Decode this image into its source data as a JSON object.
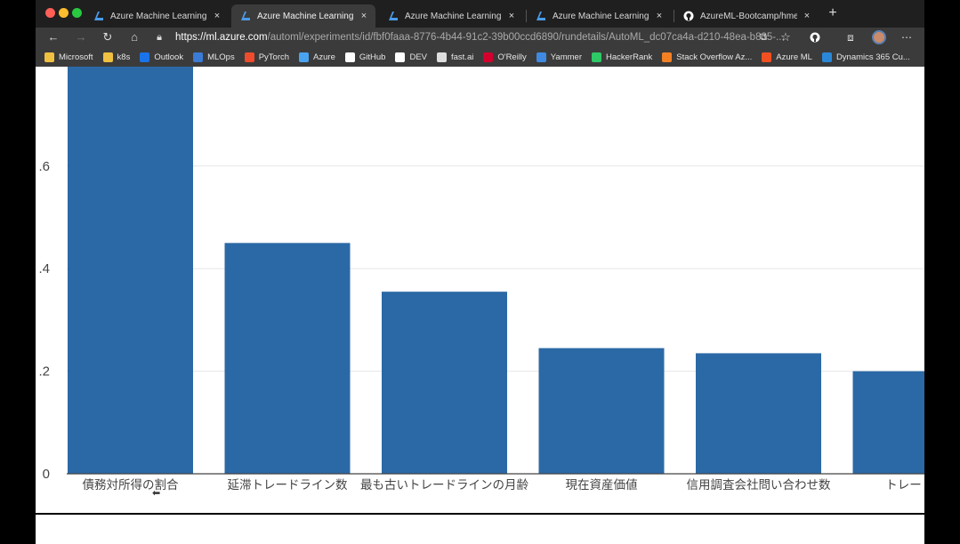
{
  "browser": {
    "tabs": [
      {
        "label": "Azure Machine Learning studio",
        "active": false,
        "icon": "azure-ml-icon"
      },
      {
        "label": "Azure Machine Learning studio",
        "active": true,
        "icon": "azure-ml-icon"
      },
      {
        "label": "Azure Machine Learning studio",
        "active": false,
        "icon": "azure-ml-icon"
      },
      {
        "label": "Azure Machine Learning studio",
        "active": false,
        "icon": "azure-ml-icon"
      },
      {
        "label": "AzureML-Bootcamp/hmeq-cla",
        "active": false,
        "icon": "github-icon"
      }
    ],
    "close_glyph": "×",
    "new_tab_glyph": "+",
    "url_host": "https://ml.azure.com",
    "url_path": "/automl/experiments/id/fbf0faaa-8776-4b44-91c2-39b00ccd6890/rundetails/AutoML_dc07ca4a-d210-48ea-b835-...",
    "bookmarks": [
      {
        "label": "Microsoft",
        "icon": "folder-icon",
        "color": "#f0c040"
      },
      {
        "label": "k8s",
        "icon": "folder-icon",
        "color": "#f0c040"
      },
      {
        "label": "Outlook",
        "icon": "outlook-icon",
        "color": "#1a73e8"
      },
      {
        "label": "MLOps",
        "icon": "mlops-icon",
        "color": "#3a7bd5"
      },
      {
        "label": "PyTorch",
        "icon": "pytorch-icon",
        "color": "#ee4c2c"
      },
      {
        "label": "Azure",
        "icon": "azure-icon",
        "color": "#4aa3f0"
      },
      {
        "label": "GitHub",
        "icon": "github-icon",
        "color": "#ffffff"
      },
      {
        "label": "DEV",
        "icon": "dev-icon",
        "color": "#ffffff"
      },
      {
        "label": "fast.ai",
        "icon": "fastai-icon",
        "color": "#dddddd"
      },
      {
        "label": "O'Reilly",
        "icon": "oreilly-icon",
        "color": "#d3002d"
      },
      {
        "label": "Yammer",
        "icon": "yammer-icon",
        "color": "#3f8ae0"
      },
      {
        "label": "HackerRank",
        "icon": "hackerrank-icon",
        "color": "#2ec866"
      },
      {
        "label": "Stack Overflow Az...",
        "icon": "stackoverflow-icon",
        "color": "#f48024"
      },
      {
        "label": "Azure ML",
        "icon": "microsoft-icon",
        "color": "#f25022"
      },
      {
        "label": "Dynamics 365 Cu...",
        "icon": "dynamics-icon",
        "color": "#2b88d8"
      }
    ]
  },
  "chart_data": {
    "type": "bar",
    "title": "",
    "xlabel": "",
    "ylabel": "",
    "categories": [
      "債務対所得の割合",
      "延滞トレードライン数",
      "最も古いトレードラインの月齢",
      "現在資産価値",
      "信用調査会社問い合わせ数",
      "トレードライン数"
    ],
    "visible_category_labels": [
      "債務対所得の割合",
      "延滞トレードライン数",
      "最も古いトレードラインの月齢",
      "現在資産価値",
      "信用調査会社問い合わせ数",
      "トレードラ"
    ],
    "values": [
      1.0,
      0.45,
      0.355,
      0.245,
      0.235,
      0.2
    ],
    "ylim": [
      0,
      0.79
    ],
    "yticks": [
      0,
      0.2,
      0.4,
      0.6
    ],
    "ytick_labels": [
      "0",
      ".2",
      ".4",
      ".6"
    ],
    "bar_color": "#2b69a6",
    "grid": true
  }
}
